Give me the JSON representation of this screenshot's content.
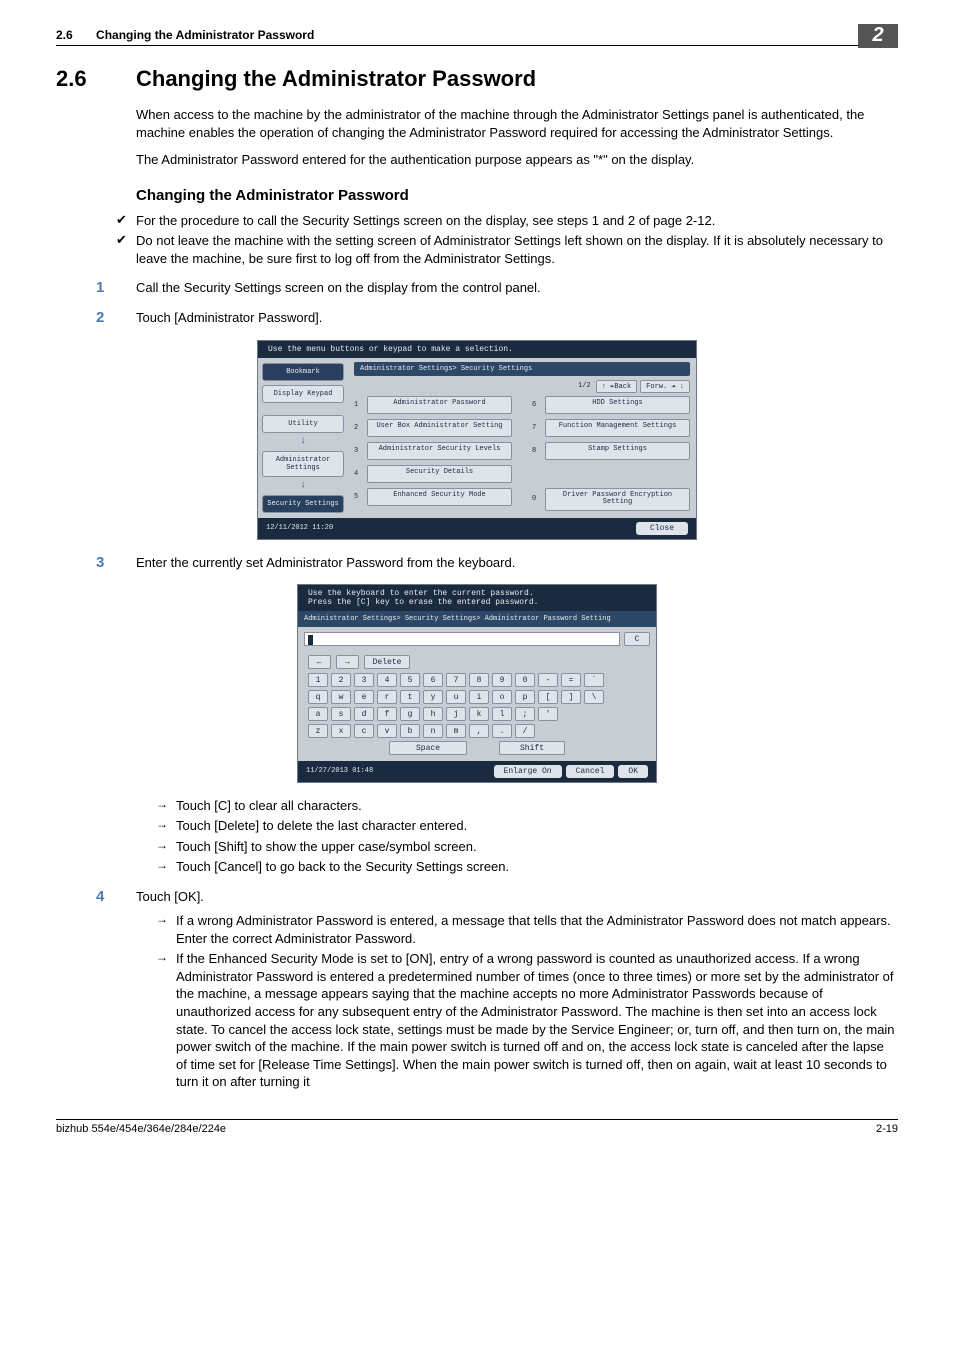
{
  "page": {
    "chapter_num": "2",
    "running_secnum": "2.6",
    "running_title": "Changing the Administrator Password",
    "footer_model": "bizhub 554e/454e/364e/284e/224e",
    "footer_page": "2-19"
  },
  "section": {
    "number": "2.6",
    "title": "Changing the Administrator Password",
    "para1": "When access to the machine by the administrator of the machine through the Administrator Settings panel is authenticated, the machine enables the operation of changing the Administrator Password required for accessing the Administrator Settings.",
    "para2": "The Administrator Password entered for the authentication purpose appears as \"*\" on the display.",
    "subhead": "Changing the Administrator Password",
    "checks": [
      "For the procedure to call the Security Settings screen on the display, see steps 1 and 2 of page 2-12.",
      "Do not leave the machine with the setting screen of Administrator Settings left shown on the display. If it is absolutely necessary to leave the machine, be sure first to log off from the Administrator Settings."
    ],
    "steps": {
      "s1": "Call the Security Settings screen on the display from the control panel.",
      "s2": "Touch [Administrator Password].",
      "s3": "Enter the currently set Administrator Password from the keyboard.",
      "s3_subs": [
        "Touch [C] to clear all characters.",
        "Touch [Delete] to delete the last character entered.",
        "Touch [Shift] to show the upper case/symbol screen.",
        "Touch [Cancel] to go back to the Security Settings screen."
      ],
      "s4": "Touch [OK].",
      "s4_subs": [
        "If a wrong Administrator Password is entered, a message that tells that the Administrator Password does not match appears. Enter the correct Administrator Password.",
        "If the Enhanced Security Mode is set to [ON], entry of a wrong password is counted as unauthorized access. If a wrong Administrator Password is entered a predetermined number of times (once to three times) or more set by the administrator of the machine, a message appears saying that the machine accepts no more Administrator Passwords because of unauthorized access for any subsequent entry of the Administrator Password. The machine is then set into an access lock state. To cancel the access lock state, settings must be made by the Service Engineer; or, turn off, and then turn on, the main power switch of the machine. If the main power switch is turned off and on, the access lock state is canceled after the lapse of time set for [Release Time Settings]. When the main power switch is turned off, then on again, wait at least 10 seconds to turn it on after turning it"
      ]
    }
  },
  "shot1": {
    "instruction": "Use the menu buttons or keypad to make a selection.",
    "crumb": "Administrator Settings> Security Settings",
    "pager_label": "1/2",
    "pager_back": "↑ ↞Back",
    "pager_fwd": "Forw. ↠ ↓",
    "side": {
      "bookmark": "Bookmark",
      "display_keypad": "Display Keypad",
      "utility": "Utility",
      "admin": "Administrator Settings",
      "security": "Security Settings"
    },
    "menuA": [
      {
        "n": "1",
        "t": "Administrator Password"
      },
      {
        "n": "2",
        "t": "User Box Administrator Setting"
      },
      {
        "n": "3",
        "t": "Administrator Security Levels"
      },
      {
        "n": "4",
        "t": "Security Details"
      },
      {
        "n": "5",
        "t": "Enhanced Security Mode"
      }
    ],
    "menuB": [
      {
        "n": "6",
        "t": "HDD Settings"
      },
      {
        "n": "7",
        "t": "Function Management Settings"
      },
      {
        "n": "8",
        "t": "Stamp Settings"
      },
      {
        "n": "",
        "t": ""
      },
      {
        "n": "0",
        "t": "Driver Password Encryption Setting"
      }
    ],
    "datetime": "12/11/2012   11:20",
    "close": "Close"
  },
  "shot2": {
    "instr1": "Use the keyboard to enter the current password.",
    "instr2": "Press the [C] key to erase the entered password.",
    "crumb": "Administrator Settings> Security Settings> Administrator Password Setting",
    "c_btn": "C",
    "nav_left": "←",
    "nav_right": "→",
    "nav_delete": "Delete",
    "row1": [
      "1",
      "2",
      "3",
      "4",
      "5",
      "6",
      "7",
      "8",
      "9",
      "0",
      "-",
      "=",
      "`"
    ],
    "row2": [
      "q",
      "w",
      "e",
      "r",
      "t",
      "y",
      "u",
      "i",
      "o",
      "p",
      "[",
      "]",
      "\\"
    ],
    "row3": [
      "a",
      "s",
      "d",
      "f",
      "g",
      "h",
      "j",
      "k",
      "l",
      ";",
      "'"
    ],
    "row4": [
      "z",
      "x",
      "c",
      "v",
      "b",
      "n",
      "m",
      ",",
      ".",
      "/"
    ],
    "space": "Space",
    "shift": "Shift",
    "datetime": "11/27/2013   01:48",
    "enlarge": "Enlarge On",
    "cancel": "Cancel",
    "ok": "OK"
  }
}
